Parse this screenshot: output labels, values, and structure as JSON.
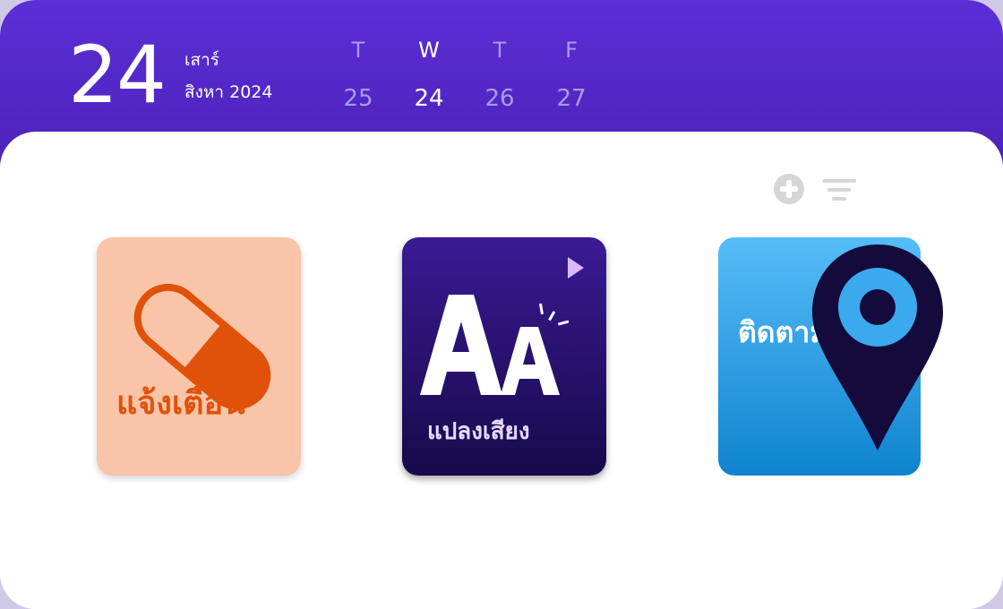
{
  "date_header": {
    "day_number": "24",
    "weekday": "เสาร์",
    "month_year": "สิงหา 2024"
  },
  "week_strip": [
    {
      "dow": "T",
      "dom": "25",
      "selected": false
    },
    {
      "dow": "W",
      "dom": "24",
      "selected": true
    },
    {
      "dow": "T",
      "dom": "26",
      "selected": false
    },
    {
      "dow": "F",
      "dom": "27",
      "selected": false
    }
  ],
  "toolbar": {
    "add_icon": "plus-circle-icon",
    "filter_icon": "filter-lines-icon"
  },
  "tiles": [
    {
      "label": "แจ้งเตือน",
      "icon": "pill-capsule-icon"
    },
    {
      "label": "แปลงเสียง",
      "icon": "text-size-aa-icon",
      "badge_icon": "play-triangle-icon"
    },
    {
      "label": "ติดตาม",
      "icon": "location-pin-icon"
    }
  ],
  "colors": {
    "header": "#5b2fd6",
    "alert_bg": "#f9c4a7",
    "alert_accent": "#e0520a",
    "voice_bg": "#2a1375",
    "track_bg": "#3aa9ee",
    "pin": "#140b3c",
    "pin_ring": "#3aa9ee"
  }
}
